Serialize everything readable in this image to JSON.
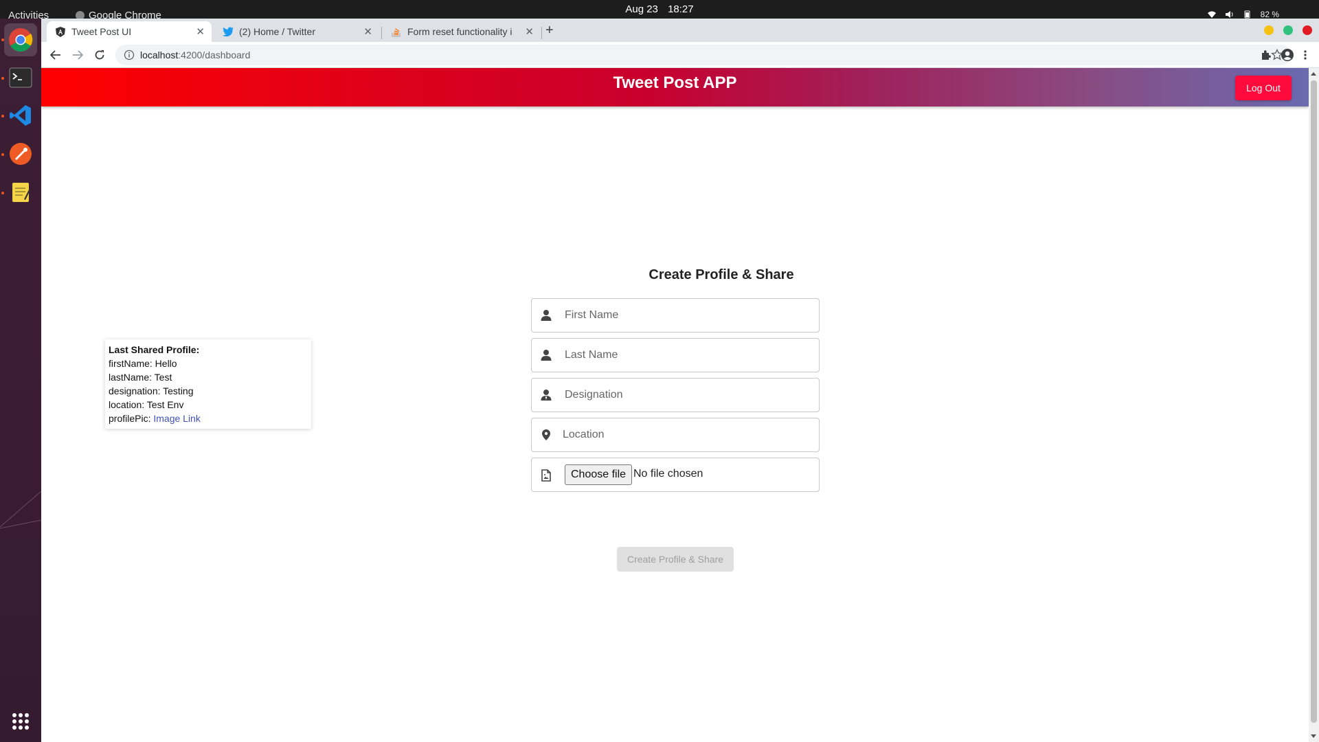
{
  "system": {
    "activities": "Activities",
    "app_menu": "Google Chrome",
    "date": "Aug 23",
    "time": "18:27",
    "battery": "82 %"
  },
  "browser": {
    "tabs": [
      {
        "title": "Tweet Post UI",
        "active": true
      },
      {
        "title": "(2) Home / Twitter",
        "active": false
      },
      {
        "title": "Form reset functionality i",
        "active": false
      }
    ],
    "url_host": "localhost",
    "url_path": ":4200/dashboard"
  },
  "header": {
    "title": "Tweet Post APP",
    "logout_label": "Log Out"
  },
  "last_profile": {
    "heading": "Last Shared Profile:",
    "first_name": "firstName: Hello",
    "last_name": "lastName: Test",
    "designation": "designation: Testing",
    "location": "location: Test Env",
    "profile_pic_label": "profilePic: ",
    "profile_pic_link": "Image Link"
  },
  "form": {
    "title": "Create Profile & Share",
    "first_name_placeholder": "First Name",
    "last_name_placeholder": "Last Name",
    "designation_placeholder": "Designation",
    "location_placeholder": "Location",
    "file_button": "Choose file",
    "file_status": "No file chosen",
    "submit_label": "Create Profile & Share"
  },
  "colors": {
    "header_start": "#ff0000",
    "header_end": "#6a6ab0",
    "logout": "#ff0a3c",
    "link": "#3f51b5"
  },
  "icons": {
    "first_name": "user-icon",
    "last_name": "user-icon",
    "designation": "user-tie-icon",
    "location": "map-marker-icon",
    "file": "file-image-icon"
  }
}
